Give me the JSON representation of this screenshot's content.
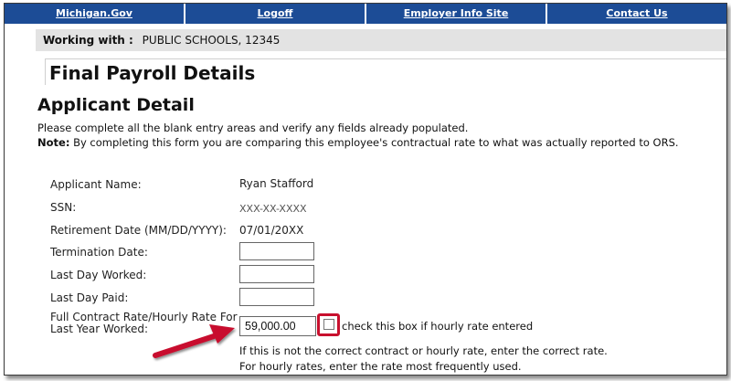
{
  "nav": {
    "items": [
      {
        "label": "Michigan.Gov"
      },
      {
        "label": "Logoff"
      },
      {
        "label": "Employer Info Site"
      },
      {
        "label": "Contact Us"
      }
    ]
  },
  "working": {
    "label": "Working with :",
    "value": "PUBLIC SCHOOLS, 12345"
  },
  "page_title": "Final Payroll Details",
  "section": {
    "title": "Applicant Detail",
    "instruction": "Please complete all the blank entry areas and verify any fields already populated.",
    "note_label": "Note:",
    "note_text": "By completing this form you are comparing this employee's contractual rate to what was actually reported to ORS."
  },
  "form": {
    "applicant_name_label": "Applicant Name:",
    "applicant_name_value": "Ryan Stafford",
    "ssn_label": "SSN:",
    "ssn_value": "XXX-XX-XXXX",
    "retirement_label": "Retirement Date (MM/DD/YYYY):",
    "retirement_value": "07/01/20XX",
    "termination_label": "Termination Date:",
    "last_worked_label": "Last Day Worked:",
    "last_paid_label": "Last Day Paid:",
    "rate_label_line1": "Full Contract Rate/Hourly Rate For",
    "rate_label_line2": "Last Year Worked:",
    "rate_value": "59,000.00",
    "hourly_checkbox_label": "check this box if hourly rate entered",
    "rate_note1": "If this is not the correct contract or hourly rate, enter the correct rate.",
    "rate_note2": "For hourly rates, enter the rate most frequently used."
  },
  "colors": {
    "nav_bg": "#1c4c96",
    "highlight": "#c8102e",
    "arrow": "#c8102e"
  }
}
